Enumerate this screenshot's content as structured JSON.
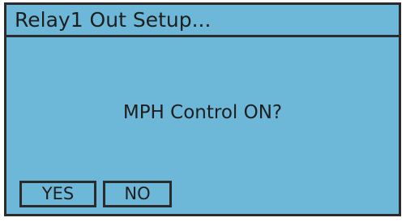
{
  "dialog": {
    "title": "Relay1 Out Setup...",
    "message": "MPH Control ON?",
    "buttons": {
      "yes_label": "YES",
      "no_label": "NO"
    }
  },
  "colors": {
    "screen_background": "#6db8d8",
    "border": "#2b2b2b",
    "text": "#1e1e1e"
  }
}
